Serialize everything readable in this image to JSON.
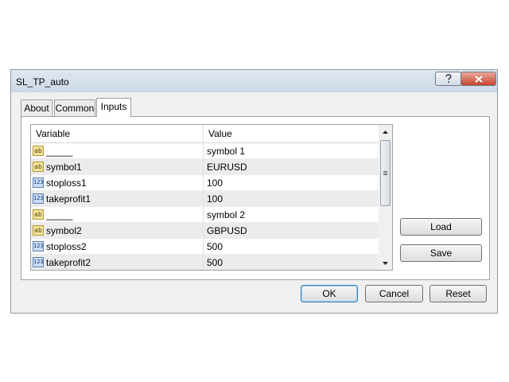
{
  "window": {
    "title": "SL_TP_auto"
  },
  "tabs": [
    {
      "label": "About"
    },
    {
      "label": "Common"
    },
    {
      "label": "Inputs"
    }
  ],
  "table": {
    "headers": {
      "variable": "Variable",
      "value": "Value"
    },
    "rows": [
      {
        "type": "string",
        "variable": "_____",
        "value": "symbol 1"
      },
      {
        "type": "string",
        "variable": "symbol1",
        "value": "EURUSD"
      },
      {
        "type": "number",
        "variable": "stoploss1",
        "value": "100"
      },
      {
        "type": "number",
        "variable": "takeprofit1",
        "value": "100"
      },
      {
        "type": "string",
        "variable": "_____",
        "value": "symbol 2"
      },
      {
        "type": "string",
        "variable": "symbol2",
        "value": "GBPUSD"
      },
      {
        "type": "number",
        "variable": "stoploss2",
        "value": "500"
      },
      {
        "type": "number",
        "variable": "takeprofit2",
        "value": "500"
      }
    ]
  },
  "icons": {
    "string_type": "ab",
    "number_type": "123"
  },
  "buttons": {
    "load": "Load",
    "save": "Save",
    "ok": "OK",
    "cancel": "Cancel",
    "reset": "Reset"
  }
}
